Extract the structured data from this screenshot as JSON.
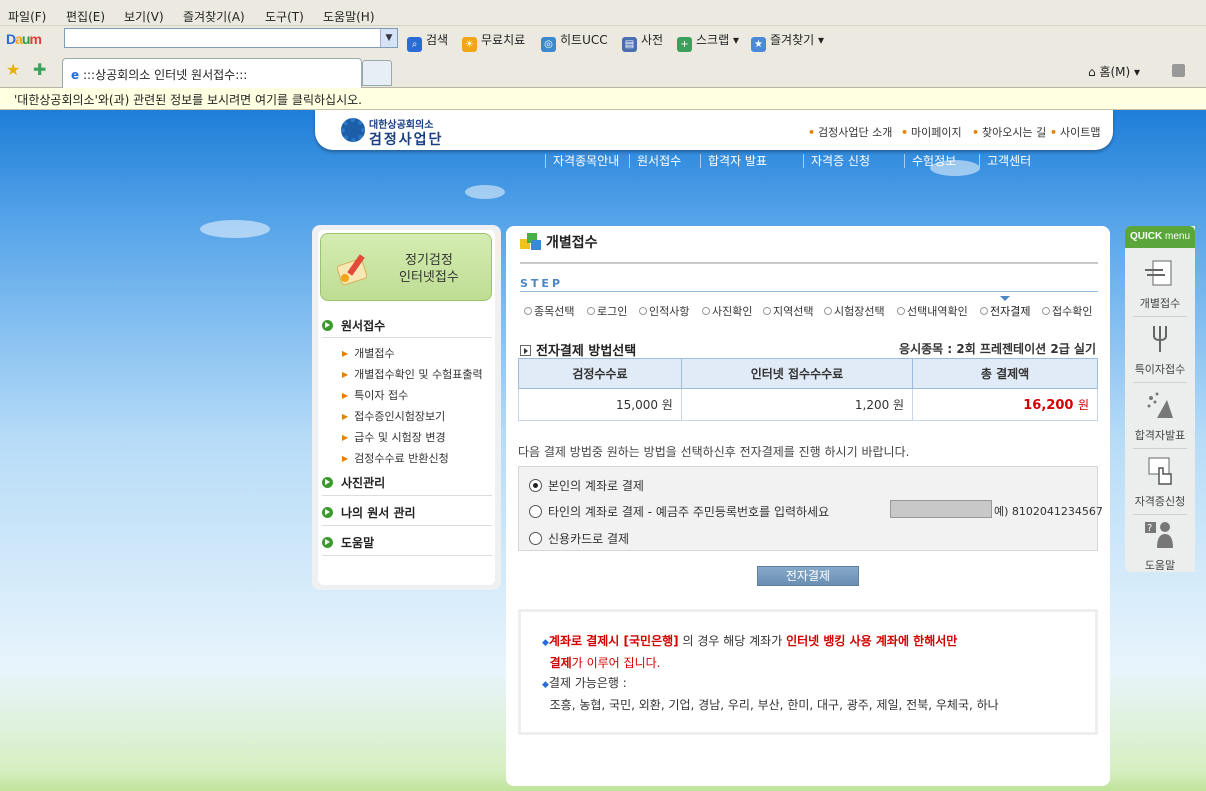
{
  "browser": {
    "menu": [
      "파일(F)",
      "편집(E)",
      "보기(V)",
      "즐겨찾기(A)",
      "도구(T)",
      "도움말(H)"
    ],
    "toolbar_brand": "Daum",
    "search_label": "검색",
    "toolbar_links": [
      "무료치료",
      "히트UCC",
      "사전",
      "스크랩",
      "즐겨찾기"
    ],
    "tab_title": ":::상공회의소 인터넷 원서접수:::",
    "home_label": "홈(M)",
    "info_bar": "'대한상공회의소'와(과) 관련된 정보를 보시려면 여기를 클릭하십시오."
  },
  "site": {
    "logo_top": "대한상공회의소",
    "logo_bottom": "검정사업단",
    "util_links": [
      "검정사업단 소개",
      "마이페이지",
      "찾아오시는 길",
      "사이트맵"
    ],
    "gnb": [
      "자격종목안내",
      "원서접수",
      "합격자 발표",
      "자격증 신청",
      "수험정보",
      "고객센터"
    ]
  },
  "left": {
    "banner_line1": "정기검정",
    "banner_line2": "인터넷접수",
    "menu1": "원서접수",
    "sub": [
      "개별접수",
      "개별접수확인 및 수험표출력",
      "특이자 접수",
      "접수증인시험장보기",
      "급수 및 시험장 변경",
      "검정수수료 반환신청"
    ],
    "menu2": "사진관리",
    "menu3": "나의 원서 관리",
    "menu4": "도움말"
  },
  "content": {
    "title": "개별접수",
    "step_label": "STEP",
    "steps": [
      "종목선택",
      "로그인",
      "인적사항",
      "사진확인",
      "지역선택",
      "시험장선택",
      "선택내역확인",
      "전자결제",
      "접수확인"
    ],
    "current_step": "전자결제",
    "section_title": "전자결제 방법선택",
    "exam_info": "응시종목 : 2회 프레젠테이션 2급 실기",
    "fee_headers": [
      "검정수수료",
      "인터넷 접수수수료",
      "총 결제액"
    ],
    "fee_exam": "15,000 원",
    "fee_internet": "1,200 원",
    "fee_total": "16,200",
    "fee_total_unit": "원",
    "guide": "다음 결제 방법중 원하는 방법을 선택하신후 전자결제를 진행 하시기 바랍니다.",
    "option1": "본인의 계좌로 결제",
    "option2": "타인의 계좌로 결제 - 예금주 주민등록번호를 입력하세요",
    "option2_example": "예) 8102041234567",
    "option3": "신용카드로 결제",
    "selected_option": "본인의 계좌로 결제",
    "pay_button": "전자결제",
    "notice1_red": "계좌로 결제시 [국민은행]",
    "notice1_mid": " 의 경우 해당 계좌가 ",
    "notice1_red2": "인터넷 뱅킹 사용 계좌에 한해서만",
    "notice2_red": "결제",
    "notice2_rest": "가 이루어 집니다.",
    "notice3": "결제 가능은행 :",
    "notice4": "조흥, 농협, 국민, 외환, 기업, 경남, 우리, 부산, 한미, 대구, 광주, 제일, 전북, 우체국, 하나"
  },
  "quick": {
    "head_bold": "QUICK",
    "head_normal": "menu",
    "items": [
      "개별접수",
      "특이자접수",
      "합격자발표",
      "자격증신청",
      "도움말"
    ]
  },
  "colors": {
    "accent_green": "#5aa63a",
    "alert_red": "#d40000",
    "sky_blue": "#1e7ed8"
  }
}
